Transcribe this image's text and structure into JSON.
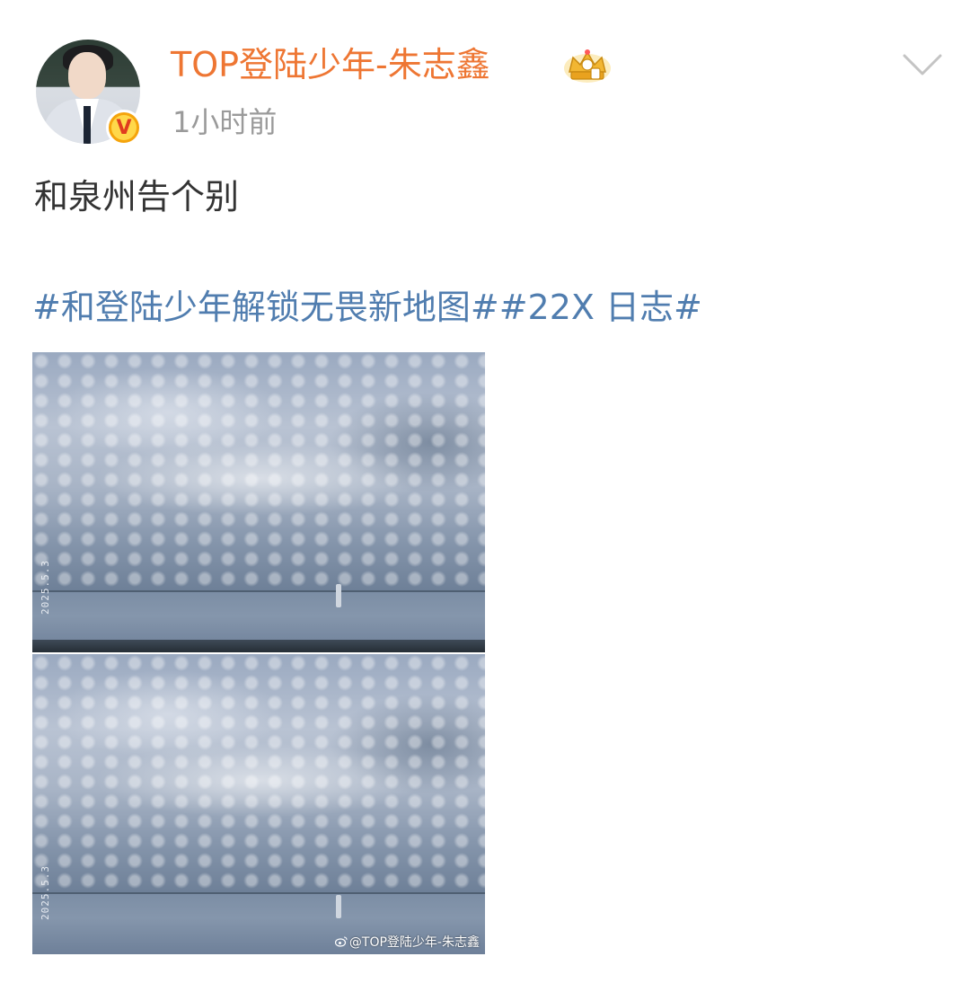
{
  "user": {
    "name": "TOP登陆少年-朱志鑫",
    "time": "1小时前",
    "verified_badge": "V"
  },
  "post": {
    "text": "和泉州告个别",
    "topics": [
      "#和登陆少年解锁无畏新地图#",
      "#22X 日志#"
    ]
  },
  "images": [
    {
      "date_stamp": "2025.5.3"
    },
    {
      "date_stamp": "2025.5.3",
      "watermark": "@TOP登陆少年-朱志鑫"
    }
  ],
  "icons": {
    "verified": "verified-v-icon",
    "crown": "crown-badge-icon",
    "more": "chevron-down-icon",
    "weibo": "weibo-logo-icon"
  },
  "colors": {
    "username": "#ee7633",
    "topic": "#507daf",
    "timestamp": "#9a9a9a",
    "text": "#333333"
  }
}
